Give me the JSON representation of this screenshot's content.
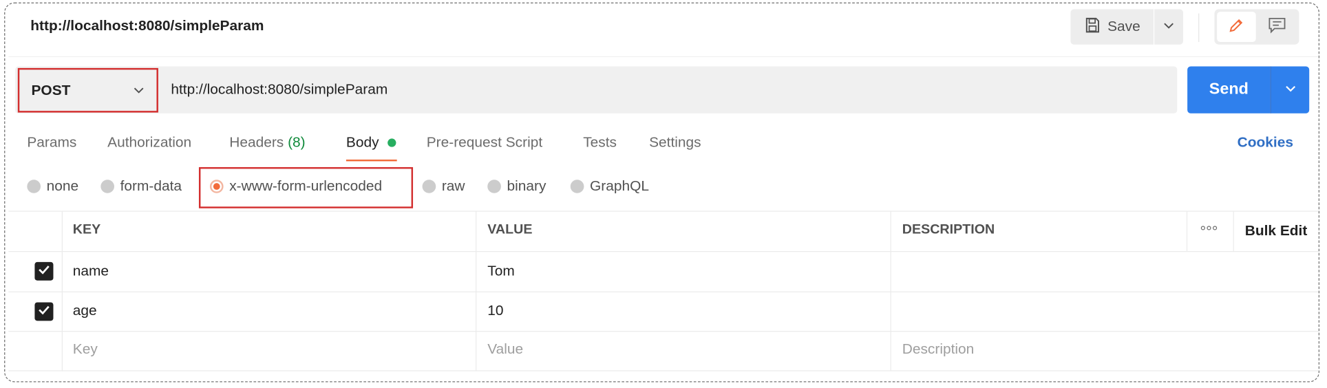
{
  "request": {
    "title": "http://localhost:8080/simpleParam",
    "method": "POST",
    "url": "http://localhost:8080/simpleParam"
  },
  "header": {
    "save_label": "Save"
  },
  "send": {
    "label": "Send"
  },
  "tabs": [
    {
      "label": "Params"
    },
    {
      "label": "Authorization"
    },
    {
      "label": "Headers",
      "count": "(8)"
    },
    {
      "label": "Body"
    },
    {
      "label": "Pre-request Script"
    },
    {
      "label": "Tests"
    },
    {
      "label": "Settings"
    }
  ],
  "active_tab": "Body",
  "cookies_label": "Cookies",
  "body_types": [
    {
      "label": "none",
      "selected": false
    },
    {
      "label": "form-data",
      "selected": false
    },
    {
      "label": "x-www-form-urlencoded",
      "selected": true
    },
    {
      "label": "raw",
      "selected": false
    },
    {
      "label": "binary",
      "selected": false
    },
    {
      "label": "GraphQL",
      "selected": false
    }
  ],
  "table": {
    "headers": {
      "key": "KEY",
      "value": "VALUE",
      "description": "DESCRIPTION",
      "bulk_edit": "Bulk Edit"
    },
    "rows": [
      {
        "checked": true,
        "key": "name",
        "value": "Tom",
        "description": ""
      },
      {
        "checked": true,
        "key": "age",
        "value": "10",
        "description": ""
      }
    ],
    "placeholders": {
      "key": "Key",
      "value": "Value",
      "description": "Description"
    }
  },
  "colors": {
    "send_blue": "#2f80ed",
    "highlight_red": "#d32f2f",
    "active_orange": "#f26b3a",
    "status_green": "#27ae60",
    "cookies_blue": "#2f6ec4"
  },
  "icons": [
    "save-icon",
    "chevron-down-icon",
    "pencil-icon",
    "comment-icon",
    "checkbox-checked-icon",
    "more-options-icon"
  ]
}
